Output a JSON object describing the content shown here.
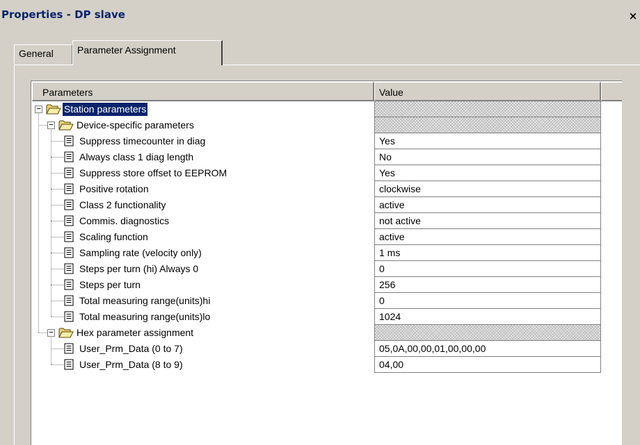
{
  "window": {
    "title": "Properties - DP slave",
    "close_label": "×"
  },
  "tabs": [
    {
      "label": "General",
      "active": false
    },
    {
      "label": "Parameter Assignment",
      "active": true
    }
  ],
  "grid": {
    "columns": [
      "Parameters",
      "Value"
    ],
    "rows": [
      {
        "level": 0,
        "type": "folder",
        "expander": "−",
        "label": "Station parameters",
        "value": "",
        "hatched": true,
        "selected": true
      },
      {
        "level": 1,
        "type": "folder",
        "expander": "−",
        "label": "Device-specific parameters",
        "value": "",
        "hatched": true
      },
      {
        "level": 2,
        "type": "param",
        "label": "Suppress timecounter in diag",
        "value": "Yes"
      },
      {
        "level": 2,
        "type": "param",
        "label": "Always class 1 diag length",
        "value": "No"
      },
      {
        "level": 2,
        "type": "param",
        "label": "Suppress store offset to EEPROM",
        "value": "Yes"
      },
      {
        "level": 2,
        "type": "param",
        "label": "Positive rotation",
        "value": "clockwise"
      },
      {
        "level": 2,
        "type": "param",
        "label": "Class 2 functionality",
        "value": "active"
      },
      {
        "level": 2,
        "type": "param",
        "label": "Commis. diagnostics",
        "value": "not active"
      },
      {
        "level": 2,
        "type": "param",
        "label": "Scaling function",
        "value": "active"
      },
      {
        "level": 2,
        "type": "param",
        "label": "Sampling rate (velocity only)",
        "value": "1 ms"
      },
      {
        "level": 2,
        "type": "param",
        "label": "Steps per turn (hi) Always 0",
        "value": "0"
      },
      {
        "level": 2,
        "type": "param",
        "label": "Steps per turn",
        "value": "256"
      },
      {
        "level": 2,
        "type": "param",
        "label": "Total measuring range(units)hi",
        "value": "0"
      },
      {
        "level": 2,
        "type": "param",
        "label": "Total measuring range(units)lo",
        "value": "1024"
      },
      {
        "level": 1,
        "type": "folder",
        "expander": "−",
        "label": "Hex parameter assignment",
        "value": "",
        "hatched": true
      },
      {
        "level": 2,
        "type": "param",
        "label": "User_Prm_Data (0 to 7)",
        "value": "05,0A,00,00,01,00,00,00"
      },
      {
        "level": 2,
        "type": "param",
        "label": "User_Prm_Data (8 to 9)",
        "value": "04,00"
      }
    ]
  },
  "icons": {
    "folder": "open-folder-icon",
    "param": "parameter-doc-icon"
  },
  "colors": {
    "selection": "#0a246a",
    "title_text": "#0a246a",
    "window_bg": "#d4d0c8"
  }
}
